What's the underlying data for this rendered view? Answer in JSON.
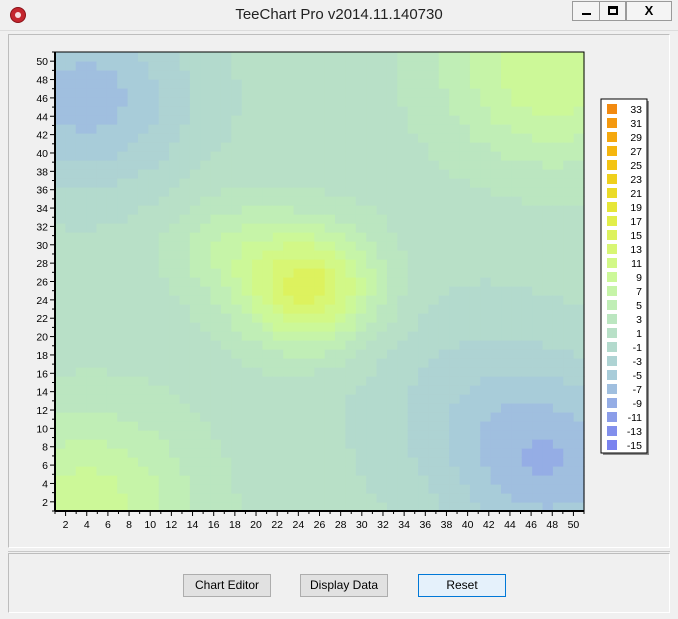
{
  "window": {
    "title": "TeeChart Pro v2014.11.140730",
    "controls": {
      "minimize": "minimize",
      "maximize": "maximize",
      "close": "X"
    }
  },
  "buttons": {
    "chart_editor": "Chart Editor",
    "display_data": "Display Data",
    "reset": "Reset"
  },
  "colors": {
    "window_bg": "#f0f0f0",
    "accent": "#0078d7"
  },
  "chart_data": {
    "type": "heatmap",
    "title": "",
    "xlabel": "",
    "ylabel": "",
    "xlim": [
      1,
      51
    ],
    "ylim": [
      1,
      51
    ],
    "x_ticks": [
      2,
      4,
      6,
      8,
      10,
      12,
      14,
      16,
      18,
      20,
      22,
      24,
      26,
      28,
      30,
      32,
      34,
      36,
      38,
      40,
      42,
      44,
      46,
      48,
      50
    ],
    "y_ticks": [
      2,
      4,
      6,
      8,
      10,
      12,
      14,
      16,
      18,
      20,
      22,
      24,
      26,
      28,
      30,
      32,
      34,
      36,
      38,
      40,
      42,
      44,
      46,
      48,
      50
    ],
    "grid": false,
    "legend_position": "right",
    "grid_size": 51,
    "value_range": [
      -15,
      33
    ],
    "legend": [
      {
        "label": "33",
        "color": "#f28a10"
      },
      {
        "label": "31",
        "color": "#f4990f"
      },
      {
        "label": "29",
        "color": "#f5a80e"
      },
      {
        "label": "27",
        "color": "#f5b60f"
      },
      {
        "label": "25",
        "color": "#f3c414"
      },
      {
        "label": "23",
        "color": "#efd01c"
      },
      {
        "label": "21",
        "color": "#ebdb28"
      },
      {
        "label": "19",
        "color": "#e6e637"
      },
      {
        "label": "17",
        "color": "#e2ee4a"
      },
      {
        "label": "15",
        "color": "#ddf25e"
      },
      {
        "label": "13",
        "color": "#d8f674"
      },
      {
        "label": "11",
        "color": "#d2f887"
      },
      {
        "label": "9",
        "color": "#ccf898"
      },
      {
        "label": "7",
        "color": "#c6f4a8"
      },
      {
        "label": "5",
        "color": "#c0eeb6"
      },
      {
        "label": "3",
        "color": "#bbe6c0"
      },
      {
        "label": "1",
        "color": "#b8e0c7"
      },
      {
        "label": "-1",
        "color": "#b3dacd"
      },
      {
        "label": "-3",
        "color": "#aed3d3"
      },
      {
        "label": "-5",
        "color": "#a8ccd9"
      },
      {
        "label": "-7",
        "color": "#a0bfdf"
      },
      {
        "label": "-9",
        "color": "#95ade5"
      },
      {
        "label": "-11",
        "color": "#8b9de9"
      },
      {
        "label": "-13",
        "color": "#828fec"
      },
      {
        "label": "-15",
        "color": "#7a83ef"
      }
    ],
    "features": [
      {
        "x": 25,
        "y": 25.5,
        "amplitude": 14,
        "sigma": 4.5
      },
      {
        "x": 17,
        "y": 30,
        "amplitude": 4,
        "sigma": 4
      },
      {
        "x": 48,
        "y": 49,
        "amplitude": 9,
        "sigma": 7
      },
      {
        "x": 4,
        "y": 2,
        "amplitude": 8,
        "sigma": 7
      },
      {
        "x": 4,
        "y": 46,
        "amplitude": -8,
        "sigma": 7
      },
      {
        "x": 48,
        "y": 6,
        "amplitude": -8,
        "sigma": 7
      },
      {
        "x": 40,
        "y": 14,
        "amplitude": -3,
        "sigma": 8
      }
    ],
    "base_value": 1
  }
}
